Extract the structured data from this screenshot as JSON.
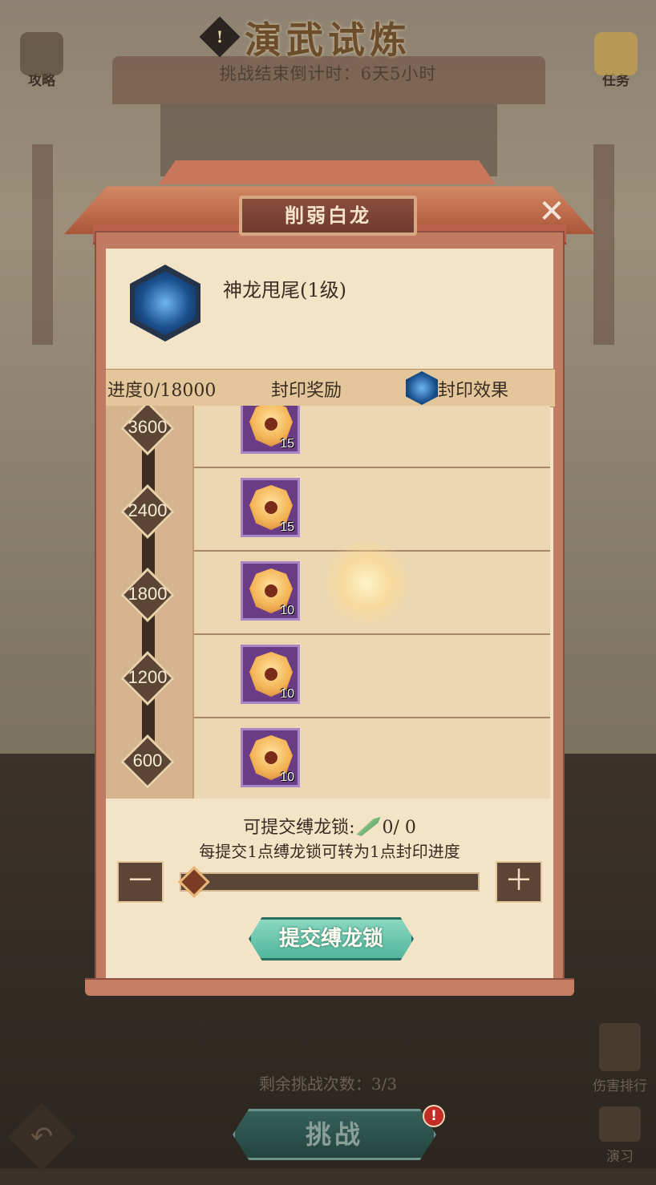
{
  "header": {
    "title": "演武试炼",
    "alert_icon": "!",
    "countdown": "挑战结束倒计时：6天5小时",
    "left_button": "攻略",
    "right_button": "任务"
  },
  "modal": {
    "title": "削弱白龙",
    "close_glyph": "✕",
    "skill": {
      "name": "神龙甩尾(1级)",
      "icon": "dragon-skill-icon"
    },
    "table_header": {
      "progress": "进度0/18000",
      "reward": "封印奖励",
      "effect": "封印效果"
    },
    "milestones": [
      {
        "threshold": "3600",
        "reward_count": "15"
      },
      {
        "threshold": "2400",
        "reward_count": "15"
      },
      {
        "threshold": "1800",
        "reward_count": "10"
      },
      {
        "threshold": "1200",
        "reward_count": "10"
      },
      {
        "threshold": "600",
        "reward_count": "10"
      }
    ],
    "submit": {
      "available_label": "可提交缚龙锁:",
      "available_value": "0/ 0",
      "hint": "每提交1点缚龙锁可转为1点封印进度",
      "minus": "－",
      "plus": "＋",
      "slider_value": 0,
      "button": "提交缚龙锁"
    }
  },
  "footer": {
    "remaining": "剩余挑战次数：3/3",
    "challenge_button": "挑战",
    "badge": "!",
    "back_glyph": "↶",
    "damage_rank": "伤害排行",
    "practice": "演习"
  },
  "colors": {
    "panel_bg": "#f3e4c7",
    "roof": "#c06d4c",
    "submit_button": "#52b69c",
    "reward_frame": "#6a3c86"
  }
}
